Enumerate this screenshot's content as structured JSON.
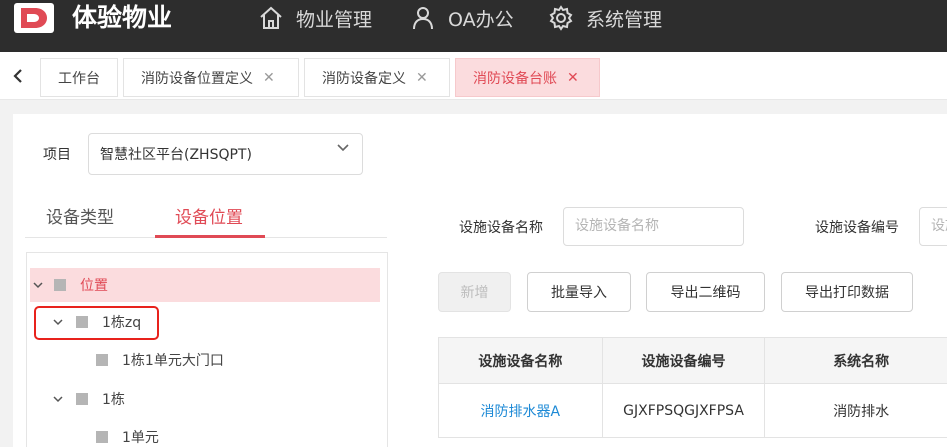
{
  "header": {
    "app_title": "体验物业",
    "logo_icon": "logo-icon",
    "nav": [
      {
        "label": "物业管理",
        "icon": "home-icon"
      },
      {
        "label": "OA办公",
        "icon": "user-icon"
      },
      {
        "label": "系统管理",
        "icon": "gear-icon"
      }
    ]
  },
  "tabs": [
    {
      "label": "工作台",
      "closable": false,
      "active": false
    },
    {
      "label": "消防设备位置定义",
      "closable": true,
      "active": false
    },
    {
      "label": "消防设备定义",
      "closable": true,
      "active": false
    },
    {
      "label": "消防设备台账",
      "closable": true,
      "active": true
    }
  ],
  "close_glyph": "✕",
  "project": {
    "label": "项目",
    "value": "智慧社区平台(ZHSQPT)"
  },
  "side_tabs": [
    {
      "label": "设备类型",
      "active": false
    },
    {
      "label": "设备位置",
      "active": true
    }
  ],
  "tree": {
    "root": "位置",
    "nodes": [
      {
        "label": "1栋zq",
        "expanded": true,
        "children": [
          "1栋1单元大门口"
        ]
      },
      {
        "label": "1栋",
        "expanded": true,
        "children": [
          "1单元"
        ]
      }
    ]
  },
  "filters": {
    "name_label": "设施设备名称",
    "name_placeholder": "设施设备名称",
    "code_label": "设施设备编号",
    "code_placeholder": "设施设备编号"
  },
  "toolbar": {
    "add": "新增",
    "batch_import": "批量导入",
    "export_qr": "导出二维码",
    "export_print": "导出打印数据"
  },
  "table": {
    "columns": [
      "设施设备名称",
      "设施设备编号",
      "系统名称"
    ],
    "rows": [
      [
        "消防排水器A",
        "GJXFPSQGJXFPSA",
        "消防排水"
      ]
    ]
  },
  "colors": {
    "header_bg": "#2d2d2d",
    "accent": "#e04a55",
    "active_tab_bg": "#fbdcde",
    "link": "#1e8ad6",
    "highlight_outline": "#e8221c"
  }
}
